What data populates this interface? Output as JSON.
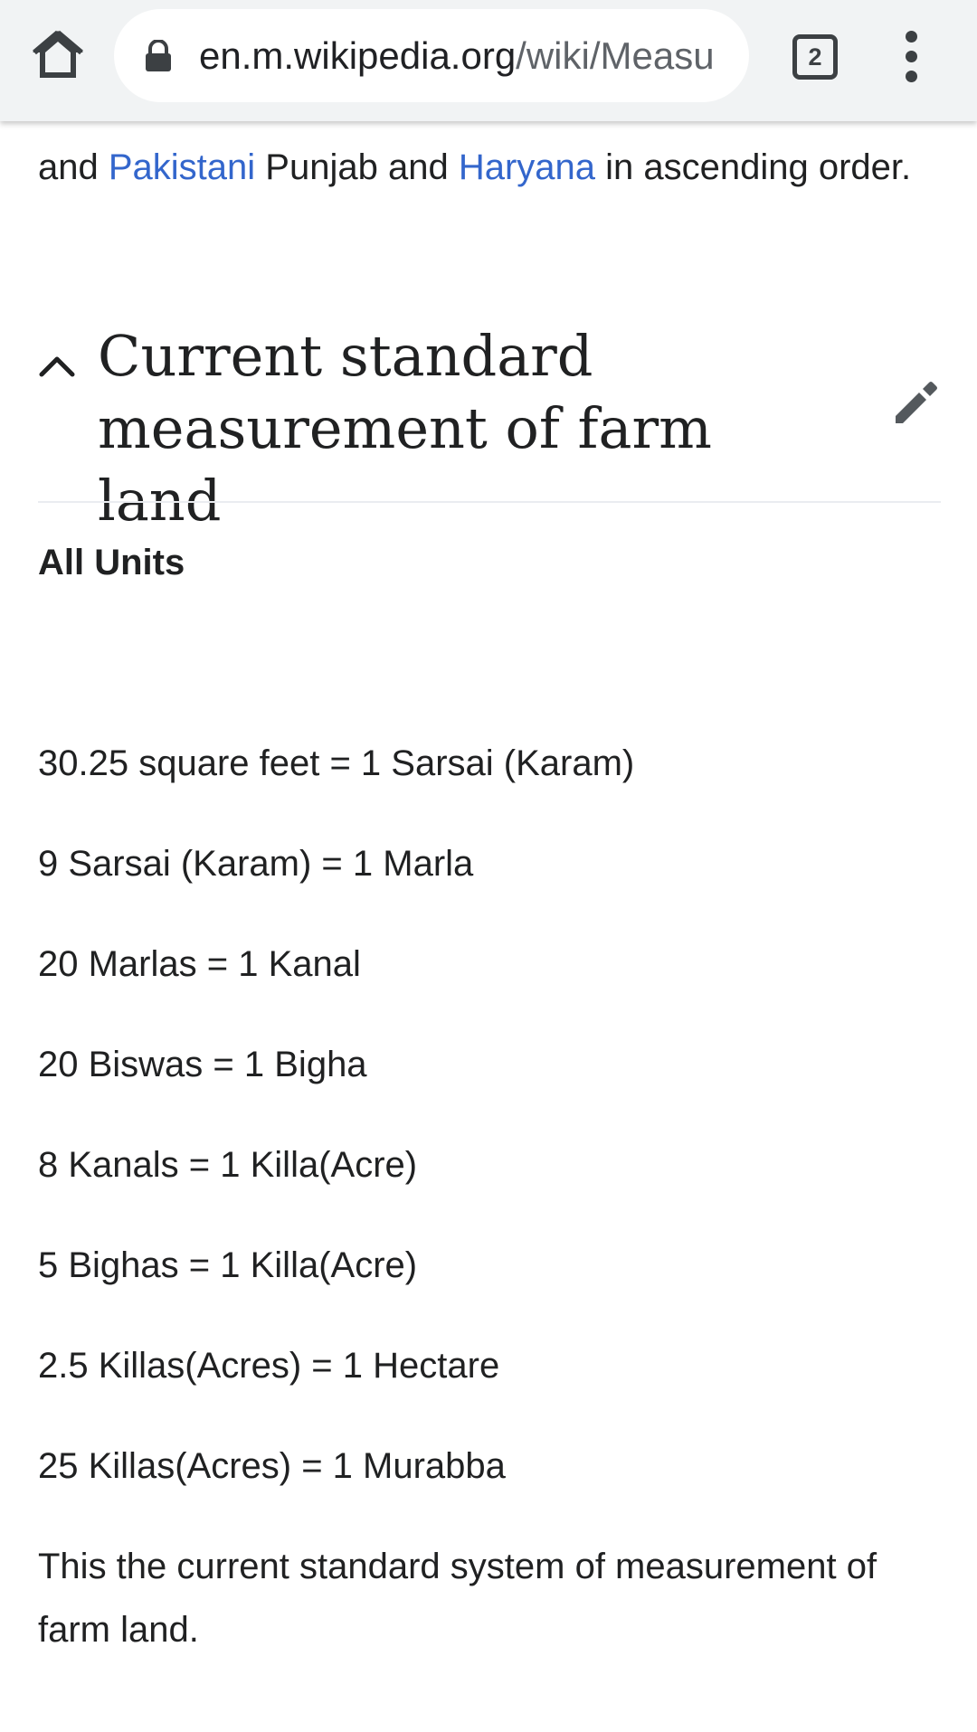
{
  "browser": {
    "url_domain": "en.m.wikipedia.org",
    "url_path": "/wiki/Measu",
    "tab_count": "2",
    "icons": [
      "home-icon",
      "lock-icon",
      "tab-switcher-icon",
      "more-options-icon"
    ]
  },
  "article": {
    "intro": {
      "part1": "and ",
      "link1": "Pakistani",
      "part2": " Punjab and ",
      "link2": "Haryana",
      "part3": " in ascending order."
    },
    "section": {
      "title": "Current standard measurement of farm land",
      "collapse_icon": "chevron-up-icon",
      "edit_icon": "pencil-icon"
    },
    "all_units_label": "All Units",
    "units": [
      "30.25 square feet = 1 Sarsai (Karam)",
      "9 Sarsai (Karam) = 1 Marla",
      "20 Marlas = 1 Kanal",
      "20 Biswas = 1 Bigha",
      "8 Kanals = 1 Killa(Acre)",
      "5 Bighas = 1 Killa(Acre)",
      "2.5 Killas(Acres) = 1 Hectare",
      "25 Killas(Acres) = 1 Murabba"
    ],
    "closing": "This the current standard system of measurement of farm land."
  },
  "colors": {
    "link": "#3366cc",
    "text": "#202122",
    "toolbar": "#f1f3f4"
  }
}
